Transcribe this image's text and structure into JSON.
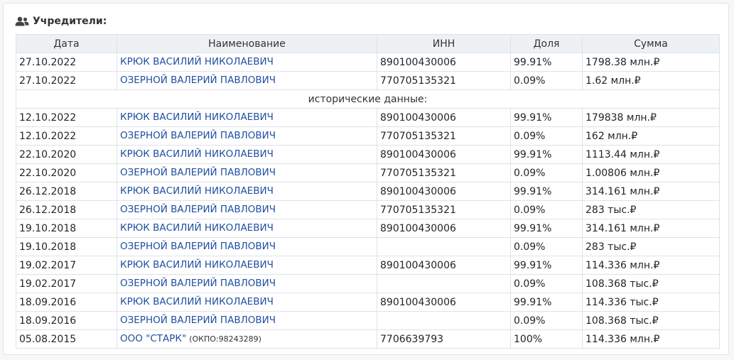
{
  "section": {
    "title": "Учредители:",
    "icon": "users-icon"
  },
  "table": {
    "headers": [
      "Дата",
      "Наименование",
      "ИНН",
      "Доля",
      "Сумма"
    ],
    "current": [
      {
        "date": "27.10.2022",
        "name": "КРЮК ВАСИЛИЙ НИКОЛАЕВИЧ",
        "okpo": "",
        "inn": "890100430006",
        "share": "99.91%",
        "sum": "1798.38 млн.₽"
      },
      {
        "date": "27.10.2022",
        "name": "ОЗЕРНОЙ ВАЛЕРИЙ ПАВЛОВИЧ",
        "okpo": "",
        "inn": "770705135321",
        "share": "0.09%",
        "sum": "1.62 млн.₽"
      }
    ],
    "history_label": "исторические данные:",
    "history": [
      {
        "date": "12.10.2022",
        "name": "КРЮК ВАСИЛИЙ НИКОЛАЕВИЧ",
        "okpo": "",
        "inn": "890100430006",
        "share": "99.91%",
        "sum": "179838 млн.₽"
      },
      {
        "date": "12.10.2022",
        "name": "ОЗЕРНОЙ ВАЛЕРИЙ ПАВЛОВИЧ",
        "okpo": "",
        "inn": "770705135321",
        "share": "0.09%",
        "sum": "162 млн.₽"
      },
      {
        "date": "22.10.2020",
        "name": "КРЮК ВАСИЛИЙ НИКОЛАЕВИЧ",
        "okpo": "",
        "inn": "890100430006",
        "share": "99.91%",
        "sum": "1113.44 млн.₽"
      },
      {
        "date": "22.10.2020",
        "name": "ОЗЕРНОЙ ВАЛЕРИЙ ПАВЛОВИЧ",
        "okpo": "",
        "inn": "770705135321",
        "share": "0.09%",
        "sum": "1.00806 млн.₽"
      },
      {
        "date": "26.12.2018",
        "name": "КРЮК ВАСИЛИЙ НИКОЛАЕВИЧ",
        "okpo": "",
        "inn": "890100430006",
        "share": "99.91%",
        "sum": "314.161 млн.₽"
      },
      {
        "date": "26.12.2018",
        "name": "ОЗЕРНОЙ ВАЛЕРИЙ ПАВЛОВИЧ",
        "okpo": "",
        "inn": "770705135321",
        "share": "0.09%",
        "sum": "283 тыс.₽"
      },
      {
        "date": "19.10.2018",
        "name": "КРЮК ВАСИЛИЙ НИКОЛАЕВИЧ",
        "okpo": "",
        "inn": "890100430006",
        "share": "99.91%",
        "sum": "314.161 млн.₽"
      },
      {
        "date": "19.10.2018",
        "name": "ОЗЕРНОЙ ВАЛЕРИЙ ПАВЛОВИЧ",
        "okpo": "",
        "inn": "",
        "share": "0.09%",
        "sum": "283 тыс.₽"
      },
      {
        "date": "19.02.2017",
        "name": "КРЮК ВАСИЛИЙ НИКОЛАЕВИЧ",
        "okpo": "",
        "inn": "890100430006",
        "share": "99.91%",
        "sum": "114.336 млн.₽"
      },
      {
        "date": "19.02.2017",
        "name": "ОЗЕРНОЙ ВАЛЕРИЙ ПАВЛОВИЧ",
        "okpo": "",
        "inn": "",
        "share": "0.09%",
        "sum": "108.368 тыс.₽"
      },
      {
        "date": "18.09.2016",
        "name": "КРЮК ВАСИЛИЙ НИКОЛАЕВИЧ",
        "okpo": "",
        "inn": "890100430006",
        "share": "99.91%",
        "sum": "114.336 тыс.₽"
      },
      {
        "date": "18.09.2016",
        "name": "ОЗЕРНОЙ ВАЛЕРИЙ ПАВЛОВИЧ",
        "okpo": "",
        "inn": "",
        "share": "0.09%",
        "sum": "108.368 тыс.₽"
      },
      {
        "date": "05.08.2015",
        "name": "ООО \"СТАРК\"",
        "okpo": "(ОКПО:98243289)",
        "inn": "7706639793",
        "share": "100%",
        "sum": "114.336 млн.₽"
      }
    ]
  },
  "colors": {
    "link": "#1f4fa0",
    "header_bg": "#eef1f4",
    "border": "#dee2e6"
  }
}
